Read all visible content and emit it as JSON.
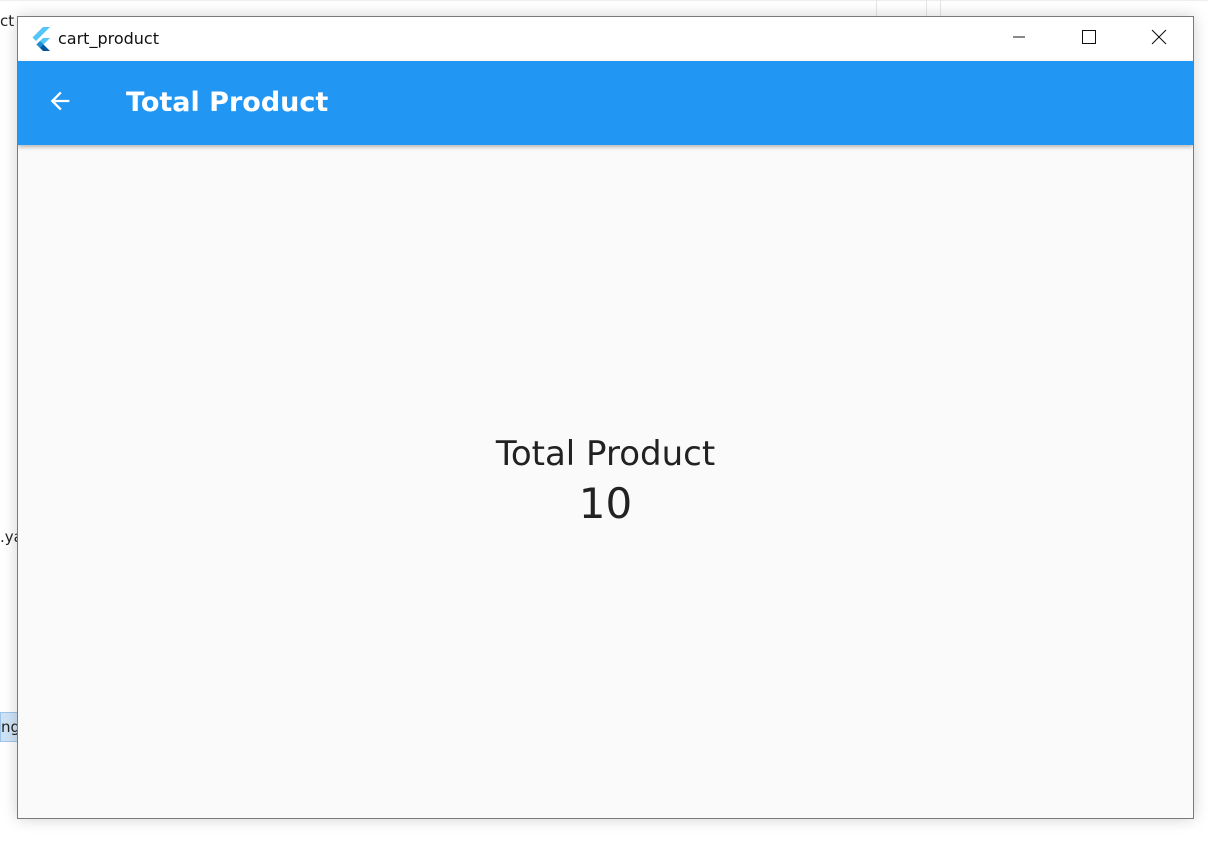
{
  "background": {
    "fragments": [
      "ct",
      ".ya",
      "ng"
    ]
  },
  "window": {
    "title": "cart_product",
    "icon": "flutter-logo-icon",
    "controls": {
      "minimize_icon": "minimize-icon",
      "maximize_icon": "maximize-icon",
      "close_icon": "close-icon"
    }
  },
  "appbar": {
    "back_icon": "arrow-back-icon",
    "title": "Total Product",
    "color": "#2196f3"
  },
  "content": {
    "label": "Total Product",
    "value": "10"
  }
}
